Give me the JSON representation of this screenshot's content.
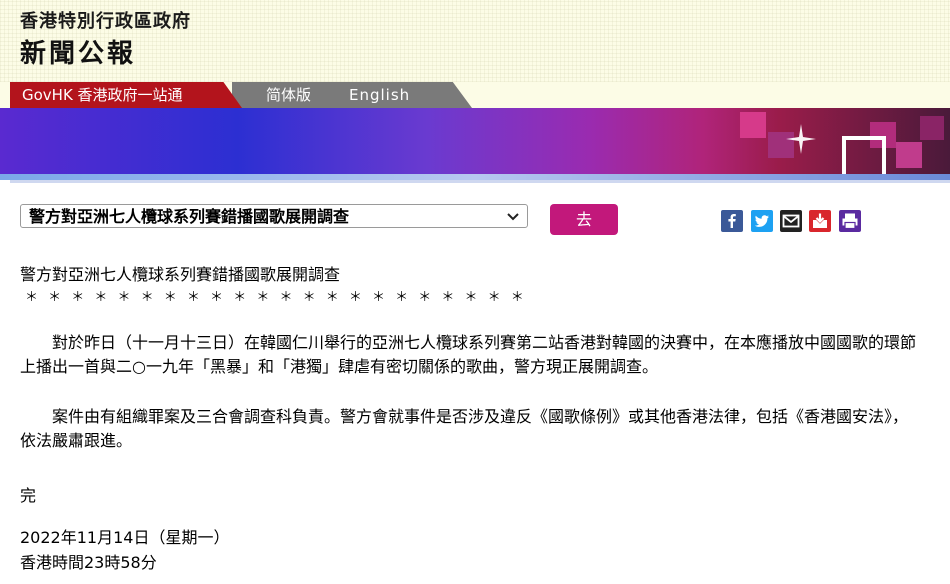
{
  "header": {
    "government_name": "香港特別行政區政府",
    "press_release_label": "新聞公報"
  },
  "nav": {
    "govhk_label": "GovHK 香港政府一站通",
    "simplified_label": "简体版",
    "english_label": "English"
  },
  "colors": {
    "brand_red": "#b3141c",
    "go_button": "#c2187b",
    "nav_grey": "#7a7a7a"
  },
  "topic_select": {
    "selected": "警方對亞洲七人欖球系列賽錯播國歌展開調查"
  },
  "go_button_label": "去",
  "share_icons": [
    "facebook-icon",
    "twitter-icon",
    "email-icon",
    "download-icon",
    "print-icon"
  ],
  "article": {
    "title": "警方對亞洲七人欖球系列賽錯播國歌展開調查",
    "separator": "＊ ＊ ＊ ＊ ＊ ＊ ＊ ＊ ＊ ＊ ＊ ＊ ＊ ＊ ＊ ＊ ＊ ＊ ＊ ＊ ＊ ＊",
    "paragraphs": [
      "對於昨日（十一月十三日）在韓國仁川舉行的亞洲七人欖球系列賽第二站香港對韓國的決賽中，在本應播放中國國歌的環節上播出一首與二○一九年「黑暴」和「港獨」肆虐有密切關係的歌曲，警方現正展開調查。",
      "案件由有組織罪案及三合會調查科負責。警方會就事件是否涉及違反《國歌條例》或其他香港法律，包括《香港國安法》，依法嚴肅跟進。"
    ],
    "end_mark": "完",
    "date": "2022年11月14日（星期一）",
    "time": "香港時間23時58分"
  }
}
